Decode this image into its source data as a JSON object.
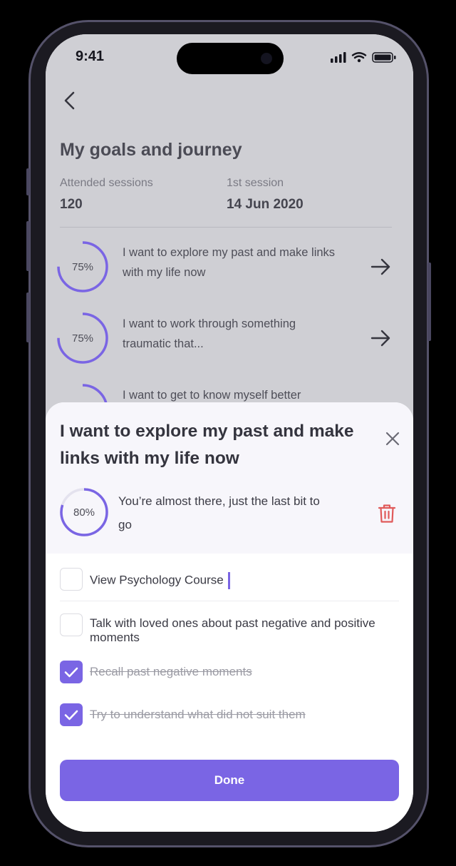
{
  "status_bar": {
    "time": "9:41"
  },
  "header": {
    "title": "My goals and journey"
  },
  "stats": [
    {
      "label": "Attended sessions",
      "value": "120"
    },
    {
      "label": "1st session",
      "value": "14 Jun 2020"
    }
  ],
  "goals": [
    {
      "progress_label": "75%",
      "progress": 0.75,
      "text": "I want to explore my past and make links with my life now"
    },
    {
      "progress_label": "75%",
      "progress": 0.75,
      "text": "I want to work through something traumatic that..."
    },
    {
      "progress_label": "",
      "progress": 0.75,
      "text": "I want to get to know myself better"
    }
  ],
  "sheet": {
    "title": "I want to explore my past and make links with my life now",
    "progress_label": "80%",
    "progress": 0.8,
    "subtitle": "You’re almost there, just the last bit to go",
    "tasks": [
      {
        "text": "View Psychology Course",
        "checked": false
      },
      {
        "text": "Talk with loved ones about past negative and positive moments",
        "checked": false
      },
      {
        "text": "Recall past negative moments",
        "checked": true
      },
      {
        "text": "Try to understand what did not suit them",
        "checked": true
      }
    ],
    "done_label": "Done"
  },
  "colors": {
    "accent": "#7a65e4",
    "delete": "#e05a5a",
    "background_dim": "#cfcfd4"
  }
}
